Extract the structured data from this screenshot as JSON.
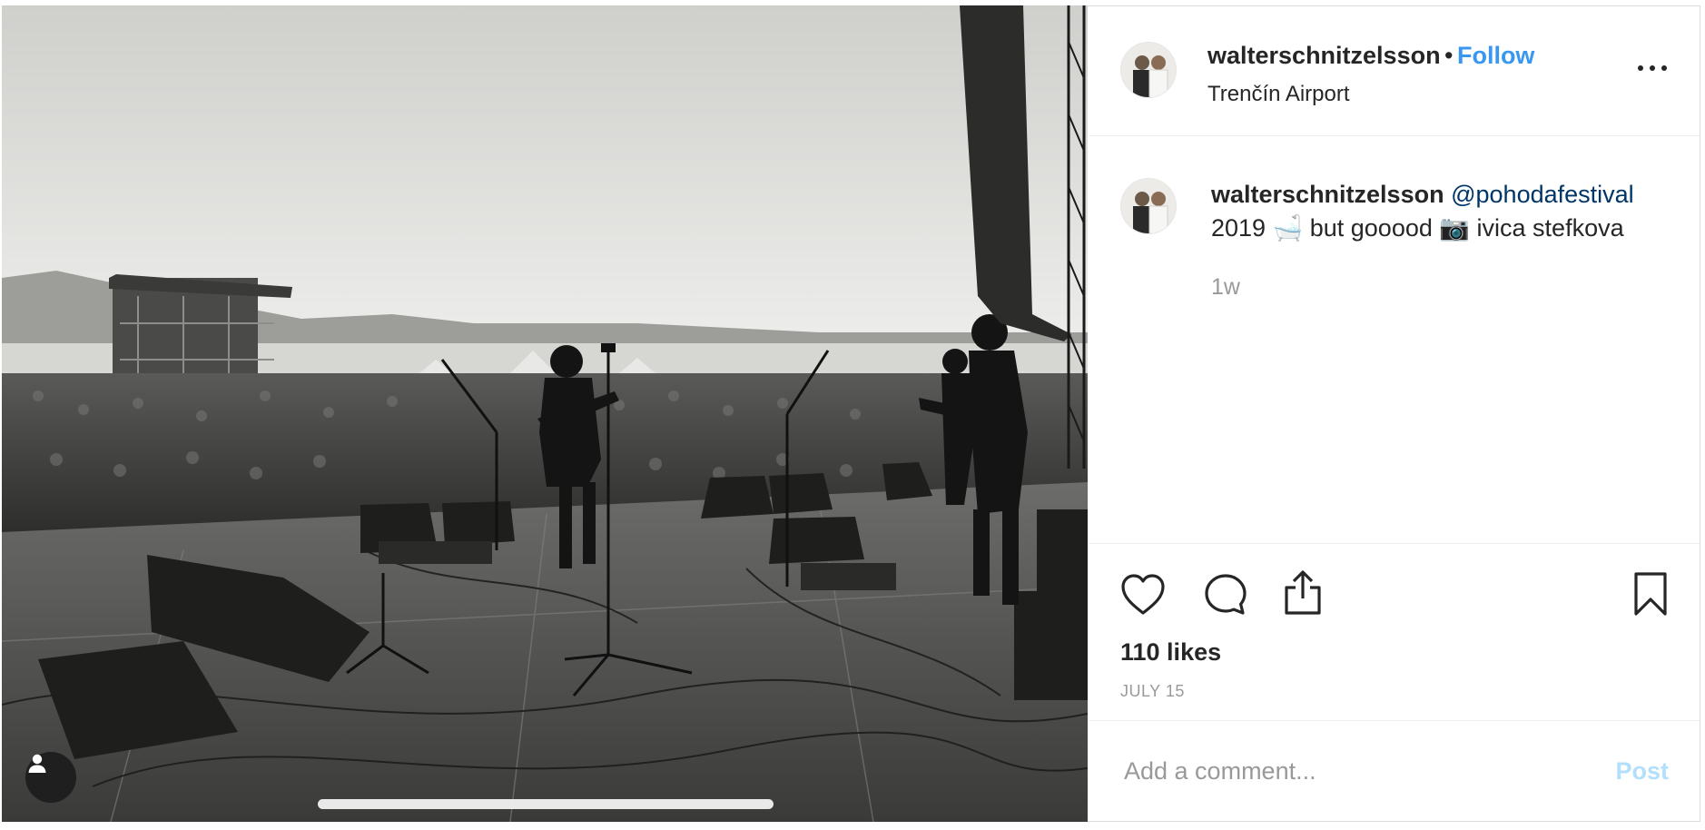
{
  "post": {
    "username": "walterschnitzelsson",
    "separator": "•",
    "follow_label": "Follow",
    "location": "Trenčín Airport",
    "more_icon": "more-horizontal-icon"
  },
  "caption": {
    "username": "walterschnitzelsson",
    "mention": "@pohodafestival",
    "text_1": "2019",
    "emoji_1": "🛁",
    "text_2": "but gooood",
    "emoji_2": "📷",
    "text_3": "ivica stefkova",
    "time_ago": "1w"
  },
  "actions": {
    "like_icon": "heart-icon",
    "comment_icon": "comment-icon",
    "share_icon": "share-icon",
    "save_icon": "bookmark-icon",
    "likes_text": "110 likes",
    "date": "JULY 15"
  },
  "comment": {
    "placeholder": "Add a comment...",
    "post_label": "Post"
  },
  "colors": {
    "accent": "#3897f0",
    "mention": "#003569",
    "muted": "#999999",
    "post_disabled": "#b2dffc"
  }
}
